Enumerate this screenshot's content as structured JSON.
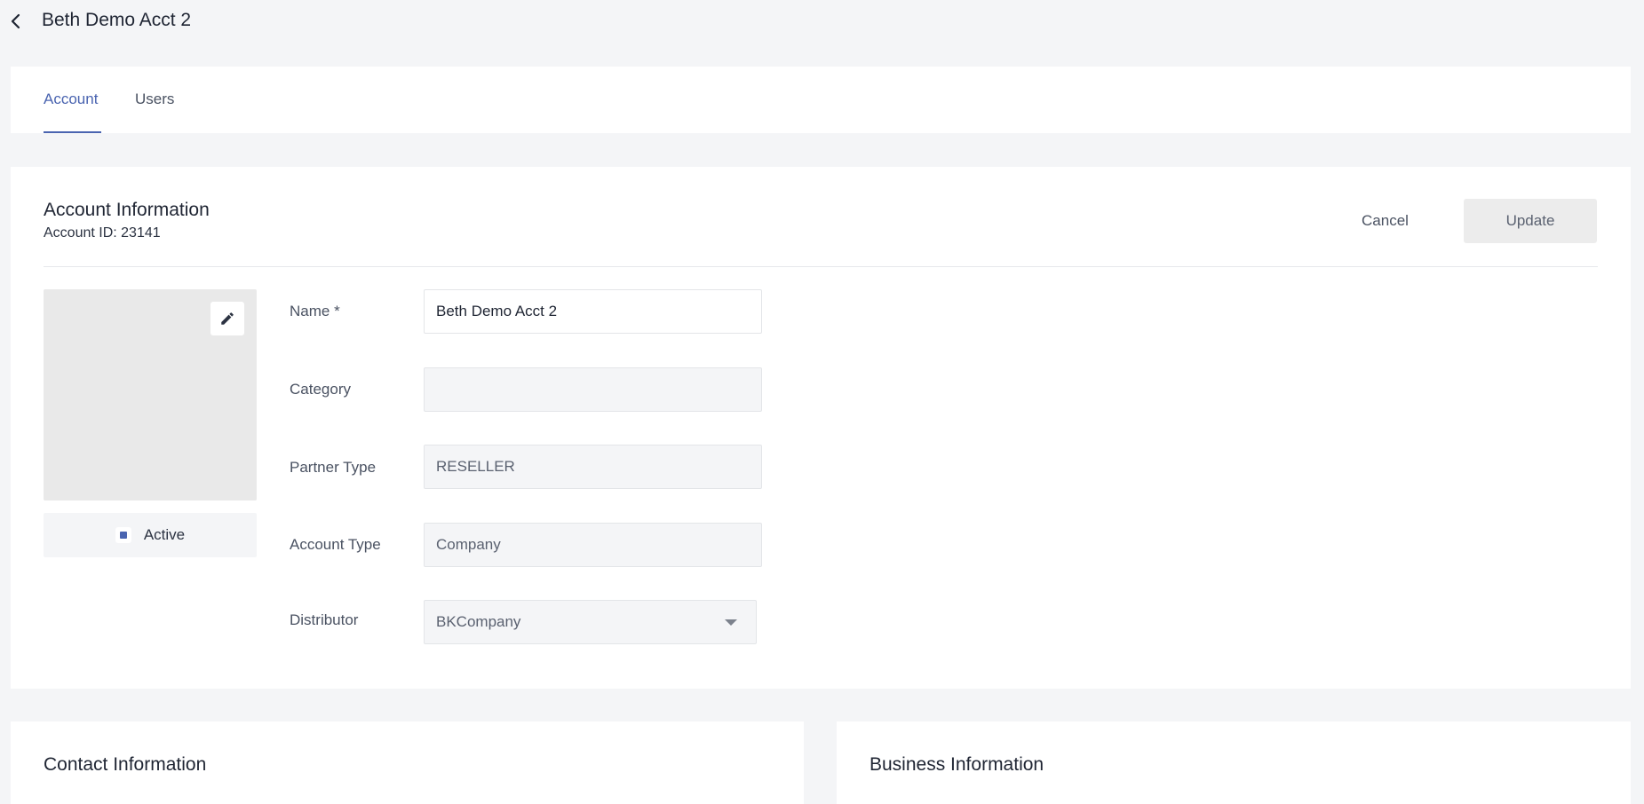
{
  "header": {
    "title": "Beth Demo Acct 2",
    "back_icon": "chevron-left-icon"
  },
  "tabs": [
    {
      "label": "Account",
      "active": true
    },
    {
      "label": "Users",
      "active": false
    }
  ],
  "account_info": {
    "title": "Account Information",
    "account_id": "Account ID: 23141",
    "cancel_label": "Cancel",
    "update_label": "Update",
    "status_label": "Active",
    "edit_icon": "pencil-icon",
    "fields": {
      "name": {
        "label": "Name *",
        "value": "Beth Demo Acct 2"
      },
      "category": {
        "label": "Category",
        "value": ""
      },
      "partner_type": {
        "label": "Partner Type",
        "value": "RESELLER"
      },
      "account_type": {
        "label": "Account Type",
        "value": "Company"
      },
      "distributor": {
        "label": "Distributor",
        "value": "BKCompany"
      }
    }
  },
  "contact_info": {
    "title": "Contact Information"
  },
  "business_info": {
    "title": "Business Information"
  },
  "colors": {
    "accent": "#4a64b0",
    "page_bg": "#f4f5f7",
    "card_bg": "#ffffff"
  }
}
